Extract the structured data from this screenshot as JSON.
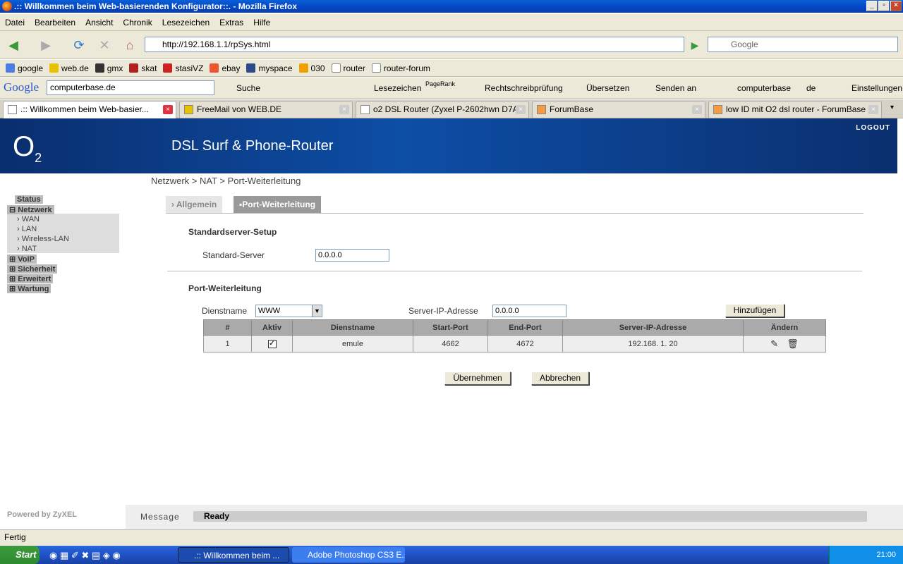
{
  "window": {
    "title": ".:: Willkommen beim Web-basierenden Konfigurator::. - Mozilla Firefox"
  },
  "menu": [
    "Datei",
    "Bearbeiten",
    "Ansicht",
    "Chronik",
    "Lesezeichen",
    "Extras",
    "Hilfe"
  ],
  "nav": {
    "url": "http://192.168.1.1/rpSys.html",
    "search_placeholder": "Google"
  },
  "bookmarks": [
    "google",
    "web.de",
    "gmx",
    "skat",
    "stasiVZ",
    "ebay",
    "myspace",
    "030",
    "router",
    "router-forum"
  ],
  "google_toolbar": {
    "logo": "Google",
    "query": "computerbase.de",
    "items": [
      "Suche",
      "Lesezeichen",
      "PageRank",
      "Rechtschreibprüfung",
      "Übersetzen",
      "Senden an",
      "computerbase",
      "de",
      "Einstellungen"
    ]
  },
  "tabs": [
    {
      "label": ".:: Willkommen beim Web-basier..."
    },
    {
      "label": "FreeMail von WEB.DE"
    },
    {
      "label": "o2 DSL Router (Zyxel P-2602hwn D7A..."
    },
    {
      "label": "ForumBase"
    },
    {
      "label": "low ID mit O2 dsl router - ForumBase"
    }
  ],
  "router": {
    "logo_main": "O",
    "logo_sub": "2",
    "product": "DSL Surf & Phone-Router",
    "logout": "LOGOUT",
    "breadcrumb": "Netzwerk > NAT > Port-Weiterleitung",
    "sidebar": {
      "status": "Status",
      "netzwerk": "Netzwerk",
      "sub": [
        "WAN",
        "LAN",
        "Wireless-LAN",
        "NAT"
      ],
      "voip": "VoIP",
      "sicherheit": "Sicherheit",
      "erweitert": "Erweitert",
      "wartung": "Wartung"
    },
    "subtabs": {
      "allgemein": "Allgemein",
      "port": "Port-Weiterleitung"
    },
    "std_section": "Standardserver-Setup",
    "std_label": "Standard-Server",
    "std_value": "0.0.0.0",
    "pf_section": "Port-Weiterleitung",
    "dienst_label": "Dienstname",
    "dienst_value": "WWW",
    "ip_label": "Server-IP-Adresse",
    "ip_value": "0.0.0.0",
    "add_btn": "Hinzufügen",
    "table_headers": [
      "#",
      "Aktiv",
      "Dienstname",
      "Start-Port",
      "End-Port",
      "Server-IP-Adresse",
      "Ändern"
    ],
    "rows": [
      {
        "num": "1",
        "active": true,
        "name": "emule",
        "start": "4662",
        "end": "4672",
        "ip": "192.168. 1. 20"
      }
    ],
    "apply_btn": "Übernehmen",
    "cancel_btn": "Abbrechen",
    "powered": "Powered by ZyXEL",
    "message_label": "Message",
    "message_value": "Ready"
  },
  "statusbar": "Fertig",
  "taskbar": {
    "start": "Start",
    "tasks": [
      ".:: Willkommen beim ...",
      "Adobe Photoshop CS3 E..."
    ],
    "clock": "21:00"
  }
}
